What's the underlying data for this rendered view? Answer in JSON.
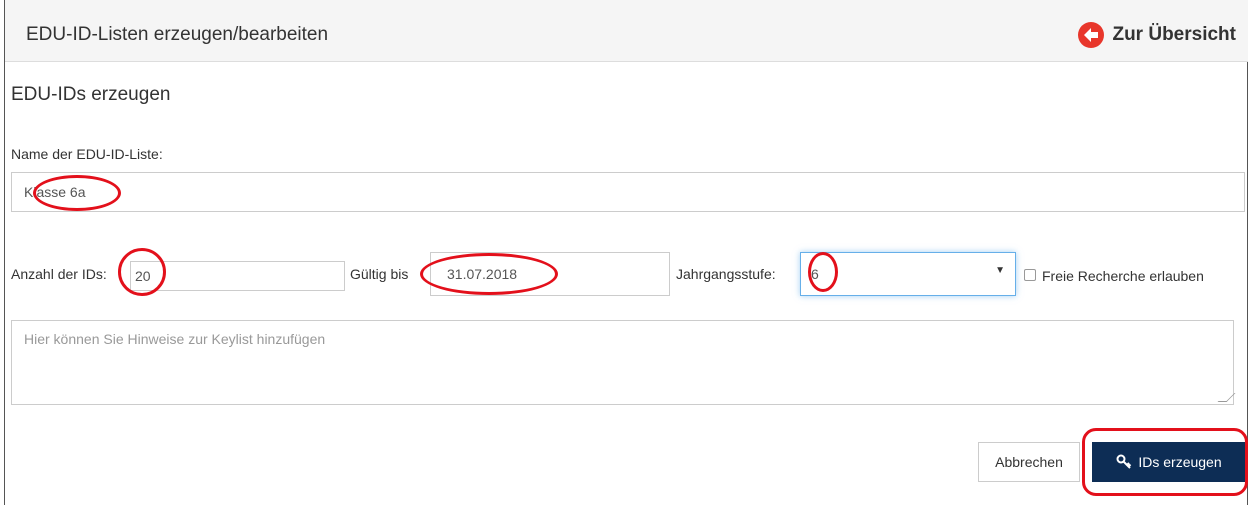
{
  "header": {
    "title": "EDU-ID-Listen erzeugen/bearbeiten",
    "overview_link": "Zur Übersicht",
    "overview_icon": "arrow-left-circle-icon"
  },
  "form": {
    "section_title": "EDU-IDs erzeugen",
    "name_label": "Name der EDU-ID-Liste:",
    "name_value": "Klasse 6a",
    "count_label": "Anzahl der IDs:",
    "count_value": "20",
    "valid_label": "Gültig bis",
    "valid_value": "31.07.2018",
    "grade_label": "Jahrgangsstufe:",
    "grade_value": "6",
    "free_research_label": "Freie Recherche erlauben",
    "free_research_checked": false,
    "notes_placeholder": "Hier können Sie Hinweise zur Keylist hinzufügen"
  },
  "actions": {
    "cancel_label": "Abbrechen",
    "generate_label": "IDs erzeugen",
    "generate_icon": "key-icon"
  },
  "colors": {
    "primary_button": "#0d2d55",
    "highlight": "#e3101b",
    "accent_icon": "#e8362b"
  }
}
